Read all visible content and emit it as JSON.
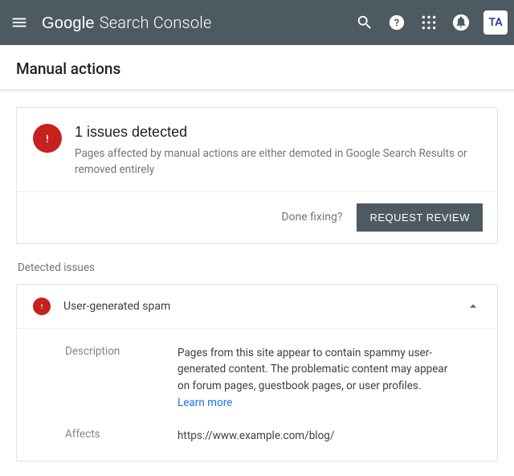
{
  "header": {
    "logo_primary": "Google",
    "logo_secondary": "Search Console",
    "avatar_initials": "TA"
  },
  "page": {
    "title": "Manual actions"
  },
  "summary": {
    "heading": "1 issues detected",
    "subtext": "Pages affected by manual actions are either demoted in Google Search Results or removed entirely",
    "done_prompt": "Done fixing?",
    "review_button": "REQUEST REVIEW"
  },
  "detected_label": "Detected issues",
  "issue": {
    "title": "User-generated spam",
    "description_label": "Description",
    "description_value": "Pages from this site appear to contain spammy user-generated content. The problematic content may appear on forum pages, guestbook pages, or user profiles.",
    "learn_more": "Learn more",
    "affects_label": "Affects",
    "affects_value": "https://www.example.com/blog/"
  }
}
